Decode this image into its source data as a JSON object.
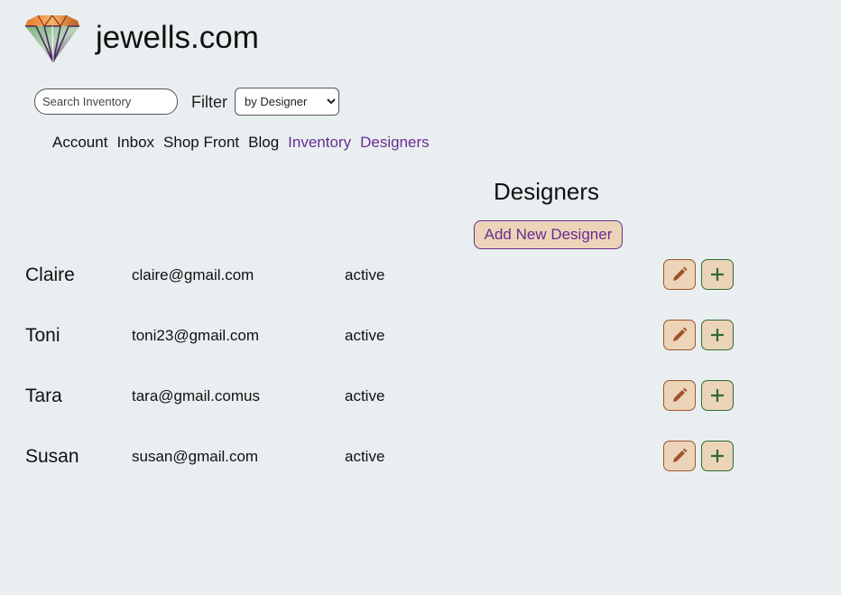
{
  "site": {
    "title": "jewells.com"
  },
  "search": {
    "placeholder": "Search Inventory",
    "value": ""
  },
  "filter": {
    "label": "Filter",
    "selected": "by Designer"
  },
  "nav": {
    "items": [
      {
        "label": "Account"
      },
      {
        "label": "Inbox"
      },
      {
        "label": "Shop Front"
      },
      {
        "label": "Blog"
      },
      {
        "label": "Inventory"
      },
      {
        "label": "Designers"
      }
    ]
  },
  "main": {
    "title": "Designers",
    "add_button_label": "Add New Designer"
  },
  "designers": [
    {
      "name": "Claire",
      "email": "claire@gmail.com",
      "status": "active"
    },
    {
      "name": "Toni",
      "email": "toni23@gmail.com",
      "status": "active"
    },
    {
      "name": "Tara",
      "email": "tara@gmail.comus",
      "status": "active"
    },
    {
      "name": "Susan",
      "email": "susan@gmail.com",
      "status": "active"
    }
  ],
  "icons": {
    "logo": "diamond-logo-icon",
    "edit": "pencil-icon",
    "add": "plus-icon"
  },
  "colors": {
    "accent": "#6a2c91",
    "button_bg": "#ecd4b8",
    "edit": "#a0522d",
    "add": "#2f6b2f",
    "page_bg": "#e9eff1"
  }
}
